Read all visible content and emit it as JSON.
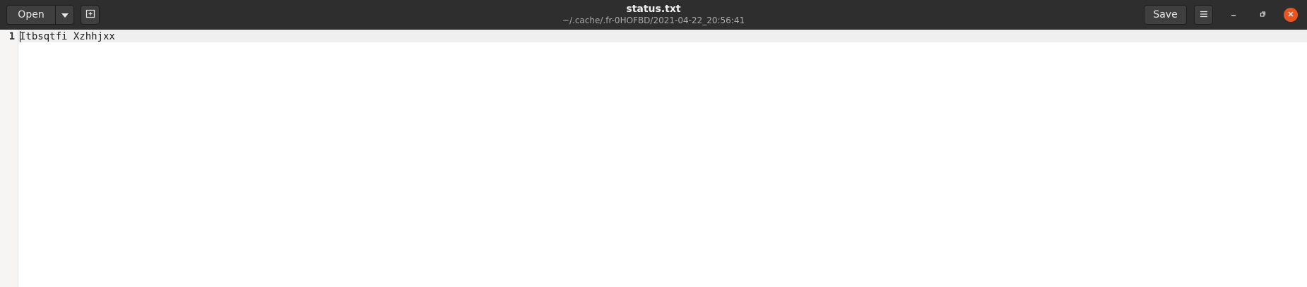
{
  "window": {
    "title": "status.txt",
    "subtitle": "~/.cache/.fr-0HOFBD/2021-04-22_20:56:41"
  },
  "header": {
    "open_label": "Open",
    "open_menu_icon": "chevron-down-icon",
    "new_tab_icon": "new-document-icon",
    "save_label": "Save",
    "menu_icon": "hamburger-menu-icon"
  },
  "window_controls": {
    "minimize_icon": "minimize-icon",
    "maximize_icon": "maximize-icon",
    "close_icon": "close-icon",
    "close_color": "#e95420"
  },
  "editor": {
    "lines": [
      {
        "number": "1",
        "text": "Itbsqtfi Xzhhjxx"
      }
    ]
  }
}
